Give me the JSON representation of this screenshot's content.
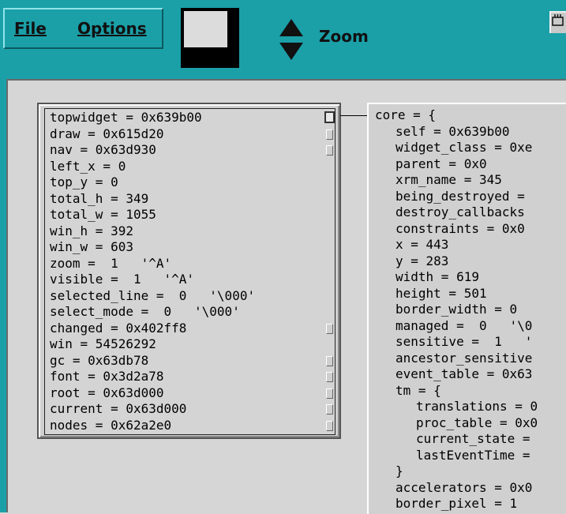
{
  "menubar": {
    "file_label": "File",
    "options_label": "Options"
  },
  "toolbar": {
    "zoom_label": "Zoom",
    "zoom_up_icon": "triangle-up-icon",
    "zoom_down_icon": "triangle-down-icon",
    "overview_icon": "panner-overview-icon"
  },
  "colors": {
    "toolbar_bg": "#1ba0a8",
    "canvas_bg": "#d6d6d6",
    "node_bg": "#d0d0d0"
  },
  "left_node": {
    "fields": [
      {
        "text": "topwidget = 0x639b00",
        "handle": "big"
      },
      {
        "text": "draw = 0x615d20",
        "handle": "small"
      },
      {
        "text": "nav = 0x63d930",
        "handle": "small"
      },
      {
        "text": "left_x = 0",
        "handle": ""
      },
      {
        "text": "top_y = 0",
        "handle": ""
      },
      {
        "text": "total_h = 349",
        "handle": ""
      },
      {
        "text": "total_w = 1055",
        "handle": ""
      },
      {
        "text": "win_h = 392",
        "handle": ""
      },
      {
        "text": "win_w = 603",
        "handle": ""
      },
      {
        "text": "zoom =  1   '^A'",
        "handle": ""
      },
      {
        "text": "visible =  1   '^A'",
        "handle": ""
      },
      {
        "text": "selected_line =  0   '\\000'",
        "handle": ""
      },
      {
        "text": "select_mode =  0   '\\000'",
        "handle": ""
      },
      {
        "text": "changed = 0x402ff8",
        "handle": "small"
      },
      {
        "text": "win = 54526292",
        "handle": ""
      },
      {
        "text": "gc = 0x63db78",
        "handle": "small"
      },
      {
        "text": "font = 0x3d2a78",
        "handle": "small"
      },
      {
        "text": "root = 0x63d000",
        "handle": "small"
      },
      {
        "text": "current = 0x63d000",
        "handle": "small"
      },
      {
        "text": "nodes = 0x62a2e0",
        "handle": "small"
      }
    ]
  },
  "right_node": {
    "lines": [
      {
        "indent": 0,
        "text": "core = {"
      },
      {
        "indent": 1,
        "text": "self = 0x639b00"
      },
      {
        "indent": 1,
        "text": "widget_class = 0xe"
      },
      {
        "indent": 1,
        "text": "parent = 0x0"
      },
      {
        "indent": 1,
        "text": "xrm_name = 345"
      },
      {
        "indent": 1,
        "text": "being_destroyed = "
      },
      {
        "indent": 1,
        "text": "destroy_callbacks "
      },
      {
        "indent": 1,
        "text": "constraints = 0x0"
      },
      {
        "indent": 1,
        "text": "x = 443"
      },
      {
        "indent": 1,
        "text": "y = 283"
      },
      {
        "indent": 1,
        "text": "width = 619"
      },
      {
        "indent": 1,
        "text": "height = 501"
      },
      {
        "indent": 1,
        "text": "border_width = 0"
      },
      {
        "indent": 1,
        "text": "managed =  0   '\\0"
      },
      {
        "indent": 1,
        "text": "sensitive =  1   '"
      },
      {
        "indent": 1,
        "text": "ancestor_sensitive"
      },
      {
        "indent": 1,
        "text": "event_table = 0x63"
      },
      {
        "indent": 1,
        "text": "tm = {"
      },
      {
        "indent": 2,
        "text": "translations = 0"
      },
      {
        "indent": 2,
        "text": "proc_table = 0x0"
      },
      {
        "indent": 2,
        "text": "current_state = "
      },
      {
        "indent": 2,
        "text": "lastEventTime = "
      },
      {
        "indent": 1,
        "text": "}"
      },
      {
        "indent": 1,
        "text": "accelerators = 0x0"
      },
      {
        "indent": 1,
        "text": "border_pixel = 1"
      }
    ]
  }
}
